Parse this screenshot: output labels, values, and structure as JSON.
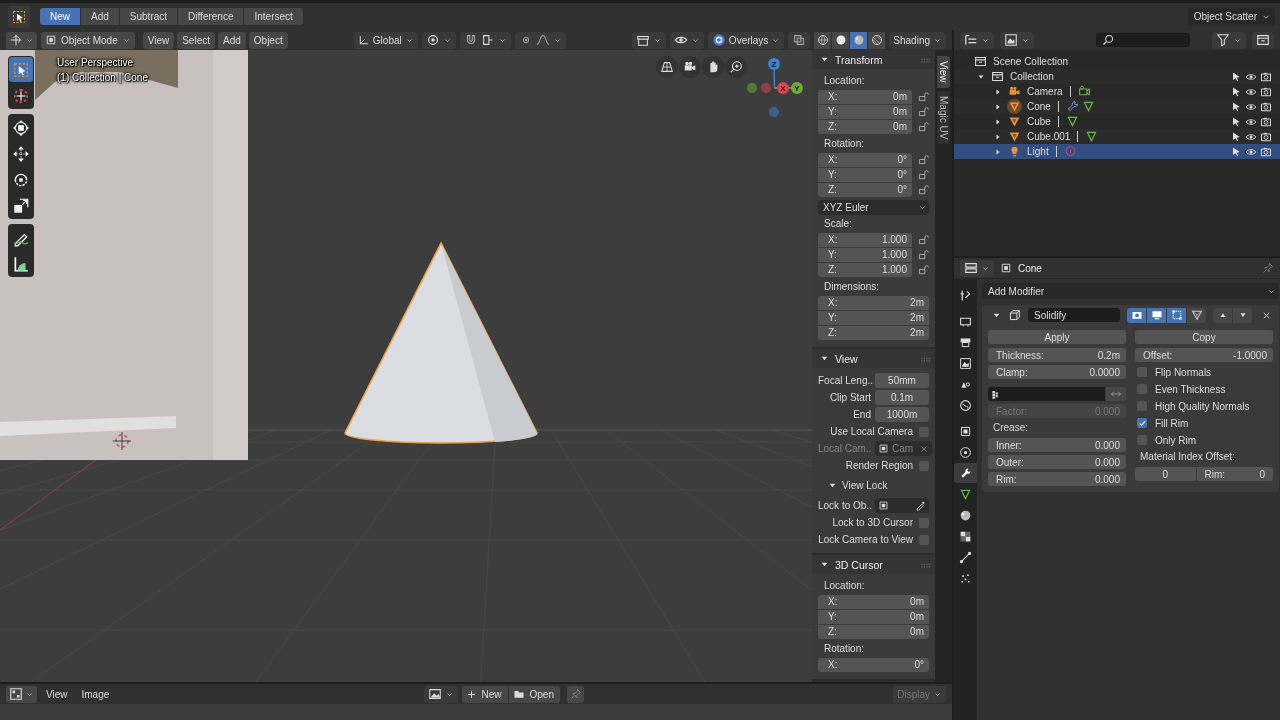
{
  "top_bar": {
    "buttons": [
      {
        "label": "New",
        "selected": true
      },
      {
        "label": "Add",
        "selected": false
      },
      {
        "label": "Subtract",
        "selected": false
      },
      {
        "label": "Difference",
        "selected": false
      },
      {
        "label": "Intersect",
        "selected": false
      }
    ],
    "preset": "Object Scatter"
  },
  "viewport_header": {
    "mode": "Object Mode",
    "menus": [
      "View",
      "Select",
      "Add",
      "Object"
    ],
    "orientation": "Global",
    "overlays": "Overlays",
    "shading_modes": [
      {
        "kind": "wireframe",
        "selected": false
      },
      {
        "kind": "solid",
        "selected": false
      },
      {
        "kind": "material",
        "selected": true
      },
      {
        "kind": "rendered",
        "selected": false
      }
    ],
    "shading": "Shading"
  },
  "viewport": {
    "info": [
      "User Perspective",
      "(1) Collection | Cone"
    ],
    "tool_groups": [
      {
        "tools": [
          {
            "kind": "select_box",
            "selected": true
          },
          {
            "kind": "cursor",
            "selected": false
          }
        ]
      },
      {
        "tools": [
          {
            "kind": "transform",
            "selected": false
          },
          {
            "kind": "move",
            "selected": false
          },
          {
            "kind": "rotate",
            "selected": false
          },
          {
            "kind": "scale",
            "selected": false
          }
        ]
      },
      {
        "tools": [
          {
            "kind": "annotate",
            "selected": false
          },
          {
            "kind": "measure",
            "selected": false
          }
        ]
      }
    ],
    "axes": [
      {
        "label": "X",
        "color": "#e0404f"
      },
      {
        "label": "Y",
        "color": "#6fa833"
      },
      {
        "label": "Z",
        "color": "#3d7fd6"
      }
    ]
  },
  "sidebar": {
    "tabs": [
      {
        "label": "View",
        "selected": true
      },
      {
        "label": "Magic UV",
        "selected": false
      }
    ],
    "panels": [
      {
        "title": "Transform",
        "expanded": true,
        "rows": [
          {
            "kind": "label",
            "text": "Location:"
          },
          {
            "kind": "vector",
            "lockable": true,
            "fields": [
              {
                "axis": "X:",
                "value": "0m"
              },
              {
                "axis": "Y:",
                "value": "0m"
              },
              {
                "axis": "Z:",
                "value": "0m"
              }
            ]
          },
          {
            "kind": "label",
            "text": "Rotation:"
          },
          {
            "kind": "vector",
            "lockable": true,
            "fields": [
              {
                "axis": "X:",
                "value": "0°"
              },
              {
                "axis": "Y:",
                "value": "0°"
              },
              {
                "axis": "Z:",
                "value": "0°"
              }
            ]
          },
          {
            "kind": "dropdown",
            "value": "XYZ Euler"
          },
          {
            "kind": "label",
            "text": "Scale:"
          },
          {
            "kind": "vector",
            "lockable": true,
            "fields": [
              {
                "axis": "X:",
                "value": "1.000"
              },
              {
                "axis": "Y:",
                "value": "1.000"
              },
              {
                "axis": "Z:",
                "value": "1.000"
              }
            ]
          },
          {
            "kind": "label",
            "text": "Dimensions:"
          },
          {
            "kind": "vector",
            "lockable": false,
            "fields": [
              {
                "axis": "X:",
                "value": "2m"
              },
              {
                "axis": "Y:",
                "value": "2m"
              },
              {
                "axis": "Z:",
                "value": "2m"
              }
            ]
          }
        ]
      },
      {
        "title": "View",
        "expanded": true,
        "rows": [
          {
            "kind": "prop",
            "label": "Focal Leng..",
            "value": "50mm"
          },
          {
            "kind": "prop",
            "label": "Clip Start",
            "value": "0.1m"
          },
          {
            "kind": "prop",
            "label": "End",
            "value": "1000m"
          },
          {
            "kind": "check",
            "label": "Use Local Camera",
            "checked": false
          },
          {
            "kind": "object_field",
            "label": "Local Cam..",
            "value": "Cam",
            "disabled": true
          },
          {
            "kind": "check",
            "label": "Render Region",
            "checked": false
          },
          {
            "kind": "subpanel",
            "title": "View Lock",
            "expanded": true,
            "rows": [
              {
                "kind": "object_field",
                "label": "Lock to Ob..",
                "disabled": false
              },
              {
                "kind": "check",
                "label": "Lock to 3D Cursor",
                "checked": false
              },
              {
                "kind": "check",
                "label": "Lock Camera to View",
                "checked": false
              }
            ]
          }
        ]
      },
      {
        "title": "3D Cursor",
        "expanded": true,
        "rows": [
          {
            "kind": "label",
            "text": "Location:"
          },
          {
            "kind": "vector",
            "lockable": false,
            "fields": [
              {
                "axis": "X:",
                "value": "0m"
              },
              {
                "axis": "Y:",
                "value": "0m"
              },
              {
                "axis": "Z:",
                "value": "0m"
              }
            ]
          },
          {
            "kind": "label",
            "text": "Rotation:"
          },
          {
            "kind": "vector",
            "lockable": false,
            "fields": [
              {
                "axis": "X:",
                "value": "0°"
              }
            ]
          }
        ]
      }
    ]
  },
  "image_header": {
    "menus": [
      "View",
      "Image"
    ],
    "new": "New",
    "open": "Open",
    "display": "Display"
  },
  "outliner": {
    "rows": [
      {
        "name": "Scene Collection",
        "kind": "scene_collection",
        "selected": false,
        "children": [
          {
            "name": "Collection",
            "kind": "collection",
            "expanded": true,
            "selected": false,
            "children": [
              {
                "name": "Camera",
                "kind": "camera",
                "expanded": false,
                "selected": false,
                "active": false,
                "data_icons": [
                  {
                    "kind": "camera_data"
                  }
                ]
              },
              {
                "name": "Cone",
                "kind": "mesh",
                "expanded": false,
                "selected": false,
                "active": true,
                "data_icons": [
                  {
                    "kind": "wrench"
                  },
                  {
                    "kind": "mesh_data"
                  }
                ]
              },
              {
                "name": "Cube",
                "kind": "mesh",
                "expanded": false,
                "selected": false,
                "active": false,
                "data_icons": [
                  {
                    "kind": "mesh_data"
                  }
                ]
              },
              {
                "name": "Cube.001",
                "kind": "mesh",
                "expanded": false,
                "selected": false,
                "active": false,
                "data_icons": [
                  {
                    "kind": "mesh_data"
                  }
                ]
              },
              {
                "name": "Light",
                "kind": "light",
                "expanded": false,
                "selected": true,
                "active": false,
                "data_icons": [
                  {
                    "kind": "light_data"
                  }
                ]
              }
            ]
          }
        ]
      }
    ]
  },
  "properties": {
    "object": "Cone",
    "tab_groups": [
      {
        "tabs": [
          {
            "kind": "tool",
            "selected": false
          }
        ]
      },
      {
        "tabs": [
          {
            "kind": "render",
            "selected": false
          },
          {
            "kind": "output",
            "selected": false
          },
          {
            "kind": "view_layer",
            "selected": false
          },
          {
            "kind": "scene",
            "selected": false
          },
          {
            "kind": "world",
            "selected": false
          }
        ]
      },
      {
        "tabs": [
          {
            "kind": "object",
            "selected": false
          },
          {
            "kind": "physics",
            "selected": false
          },
          {
            "kind": "modifiers",
            "selected": true
          },
          {
            "kind": "data",
            "selected": false
          },
          {
            "kind": "material",
            "selected": false
          },
          {
            "kind": "texture",
            "selected": false
          },
          {
            "kind": "constraints",
            "selected": false
          },
          {
            "kind": "particles",
            "selected": false
          }
        ]
      }
    ],
    "add_modifier": "Add Modifier",
    "modifier": {
      "name": "Solidify",
      "expanded": true,
      "toggles": [
        {
          "kind": "render",
          "on": true
        },
        {
          "kind": "viewport",
          "on": true
        },
        {
          "kind": "editmode",
          "on": true
        },
        {
          "kind": "cage",
          "on": false
        }
      ],
      "buttons": [
        "Apply",
        "Copy"
      ],
      "left": [
        {
          "kind": "number",
          "label": "Thickness:",
          "value": "0.2m",
          "disabled": false
        },
        {
          "kind": "number",
          "label": "Clamp:",
          "value": "0.0000",
          "disabled": false
        },
        {
          "kind": "vertex_group"
        },
        {
          "kind": "number",
          "label": "Factor:",
          "value": "0.000",
          "disabled": true
        },
        {
          "kind": "label",
          "text": "Crease:"
        },
        {
          "kind": "number",
          "label": "Inner:",
          "value": "0.000",
          "disabled": false
        },
        {
          "kind": "number",
          "label": "Outer:",
          "value": "0.000",
          "disabled": false
        },
        {
          "kind": "number",
          "label": "Rim:",
          "value": "0.000",
          "disabled": false
        }
      ],
      "right": [
        {
          "kind": "number",
          "label": "Offset:",
          "value": "-1.0000",
          "disabled": false
        },
        {
          "kind": "check",
          "label": "Flip Normals",
          "checked": false
        },
        {
          "kind": "check",
          "label": "Even Thickness",
          "checked": false
        },
        {
          "kind": "check",
          "label": "High Quality Normals",
          "checked": false
        },
        {
          "kind": "check",
          "label": "Fill Rim",
          "checked": true
        },
        {
          "kind": "check",
          "label": "Only Rim",
          "checked": false
        },
        {
          "kind": "label",
          "text": "Material Index Offset:"
        },
        {
          "kind": "pair",
          "fields": [
            {
              "value": "0"
            },
            {
              "label": "Rim:",
              "value": "0"
            }
          ]
        }
      ]
    }
  }
}
